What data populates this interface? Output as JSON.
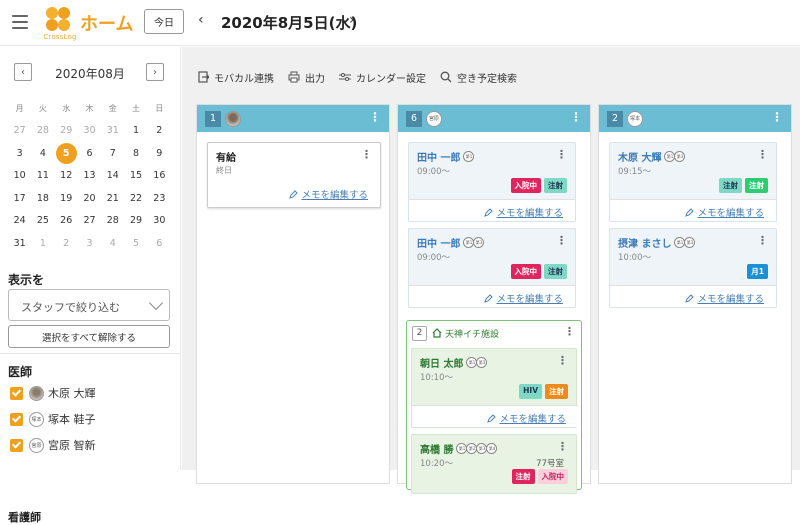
{
  "header": {
    "logo_sub": "CrossLog",
    "title": "ホーム",
    "today_label": "今日",
    "prev": "‹",
    "next": "›",
    "current_date": "2020年8月5日(水)"
  },
  "sidebar": {
    "calendar": {
      "month": "2020年08月",
      "prev": "‹",
      "next": "›",
      "weekdays": [
        "月",
        "火",
        "水",
        "木",
        "金",
        "土",
        "日"
      ],
      "weeks": [
        [
          {
            "d": "27",
            "dim": true
          },
          {
            "d": "28",
            "dim": true
          },
          {
            "d": "29",
            "dim": true
          },
          {
            "d": "30",
            "dim": true
          },
          {
            "d": "31",
            "dim": true
          },
          {
            "d": "1"
          },
          {
            "d": "2"
          }
        ],
        [
          {
            "d": "3"
          },
          {
            "d": "4"
          },
          {
            "d": "5",
            "sel": true
          },
          {
            "d": "6"
          },
          {
            "d": "7"
          },
          {
            "d": "8"
          },
          {
            "d": "9"
          }
        ],
        [
          {
            "d": "10"
          },
          {
            "d": "11"
          },
          {
            "d": "12"
          },
          {
            "d": "13"
          },
          {
            "d": "14"
          },
          {
            "d": "15"
          },
          {
            "d": "16"
          }
        ],
        [
          {
            "d": "17"
          },
          {
            "d": "18"
          },
          {
            "d": "19"
          },
          {
            "d": "20"
          },
          {
            "d": "21"
          },
          {
            "d": "22"
          },
          {
            "d": "23"
          }
        ],
        [
          {
            "d": "24"
          },
          {
            "d": "25"
          },
          {
            "d": "26"
          },
          {
            "d": "27"
          },
          {
            "d": "28"
          },
          {
            "d": "29"
          },
          {
            "d": "30"
          }
        ],
        [
          {
            "d": "31"
          },
          {
            "d": "1",
            "dim": true
          },
          {
            "d": "2",
            "dim": true
          },
          {
            "d": "3",
            "dim": true
          },
          {
            "d": "4",
            "dim": true
          },
          {
            "d": "5",
            "dim": true
          },
          {
            "d": "6",
            "dim": true
          }
        ]
      ]
    },
    "display_label": "表示を",
    "filter_placeholder": "スタッフで絞り込む",
    "clear_all": "選択をすべて解除する",
    "group_doctor": "医師",
    "staff": [
      {
        "name": "木原 大輝",
        "avatar": "",
        "photo": true
      },
      {
        "name": "塚本 鞋子",
        "avatar": "塚本",
        "photo": false
      },
      {
        "name": "宮原 智新",
        "avatar": "宮原",
        "photo": false
      }
    ],
    "next_group": "看護師"
  },
  "toolbar": {
    "mobile": "モバカル連携",
    "print": "出力",
    "calendar_settings": "カレンダー設定",
    "search_free": "空き予定検索"
  },
  "columns": [
    {
      "count": "1",
      "avatar": "",
      "photo": true
    },
    {
      "count": "6",
      "avatar": "宮原",
      "photo": false
    },
    {
      "count": "2",
      "avatar": "塚本",
      "photo": false
    }
  ],
  "col1": {
    "leave_title": "有給",
    "leave_sub": "終日",
    "memo": "メモを編集する"
  },
  "col2": {
    "p1": {
      "name": "田中 一郎",
      "icons": [
        "第1"
      ],
      "time": "09:00〜",
      "tags": [
        "入院中",
        "注射"
      ]
    },
    "p2": {
      "name": "田中 一郎",
      "icons": [
        "第1",
        "第3"
      ],
      "time": "09:00〜",
      "tags": [
        "入院中",
        "注射"
      ]
    },
    "memo": "メモを編集する",
    "facility": {
      "count": "2",
      "name": "天神イチ施設"
    },
    "p3": {
      "name": "朝日 太郎",
      "icons": [
        "第1",
        "第3"
      ],
      "time": "10:10〜",
      "tags": [
        "HIV",
        "注射"
      ]
    },
    "p4": {
      "name": "高橋 勝",
      "icons": [
        "第1",
        "第2",
        "第3",
        "第4"
      ],
      "time": "10:20〜",
      "room": "77号室",
      "tags": [
        "注射",
        "入院中"
      ]
    }
  },
  "col3": {
    "p1": {
      "name": "木原 大輝",
      "icons": [
        "第1",
        "第3"
      ],
      "time": "09:15〜",
      "tags": [
        "注射",
        "注射"
      ]
    },
    "p2": {
      "name": "摂津 まさし",
      "icons": [
        "第1",
        "第3"
      ],
      "time": "10:00〜",
      "tags": [
        "月1"
      ]
    },
    "memo": "メモを編集する"
  },
  "colors": {
    "accent": "#f0a020",
    "column_header": "#6bbdd4",
    "link": "#4a7fb0"
  }
}
